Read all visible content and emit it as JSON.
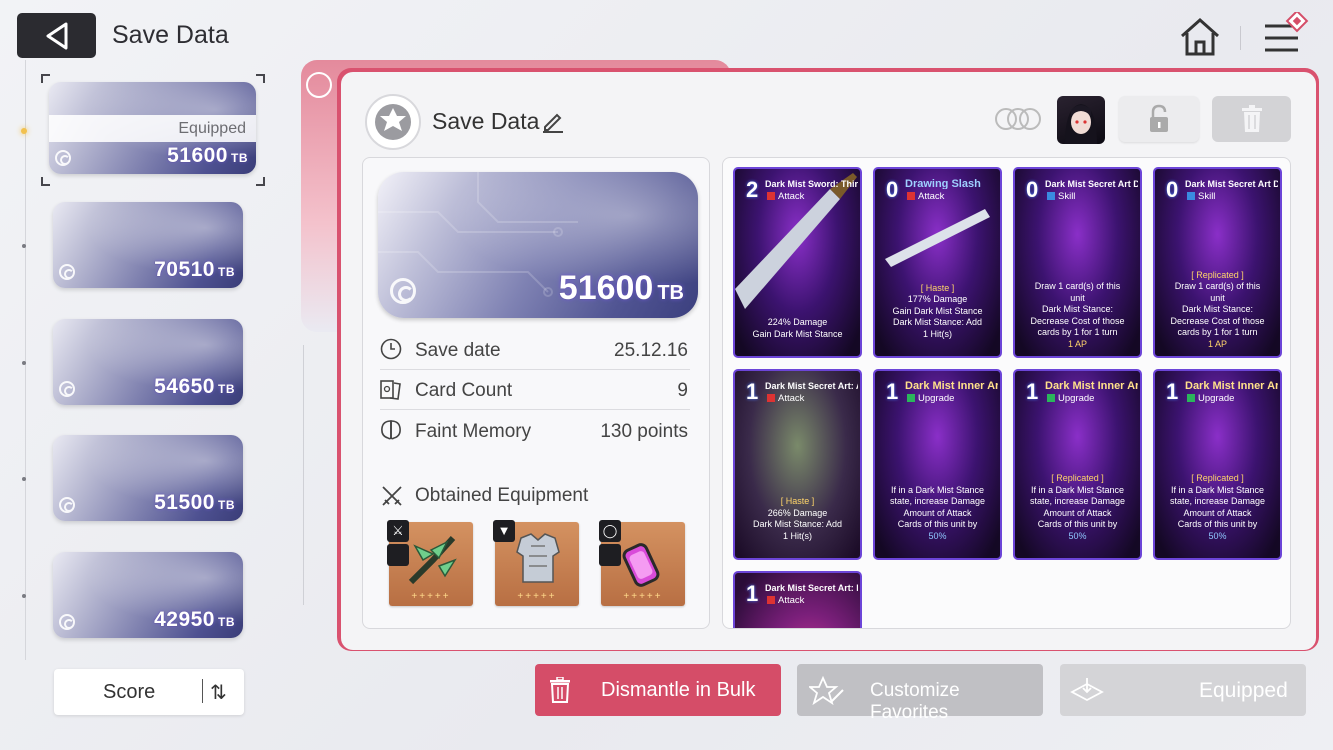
{
  "header": {
    "title": "Save Data",
    "back_icon": "back-arrow-icon",
    "home_icon": "home-icon",
    "menu_icon": "menu-icon"
  },
  "save_list": [
    {
      "value": "51600",
      "unit": "TB",
      "equipped_label": "Equipped",
      "selected": true
    },
    {
      "value": "70510",
      "unit": "TB"
    },
    {
      "value": "54650",
      "unit": "TB"
    },
    {
      "value": "51500",
      "unit": "TB"
    },
    {
      "value": "42950",
      "unit": "TB"
    }
  ],
  "sort": {
    "label": "Score"
  },
  "detail": {
    "title": "Save Data",
    "tb_value": "51600",
    "tb_unit": "TB",
    "rows": [
      {
        "label": "Save date",
        "value": "25.12.16",
        "icon": "clock-icon"
      },
      {
        "label": "Card Count",
        "value": "9",
        "icon": "cards-icon"
      },
      {
        "label": "Faint Memory",
        "value": "130 points",
        "icon": "brain-icon"
      }
    ],
    "equipment_title": "Obtained Equipment",
    "equipment": [
      {
        "name": "weapon",
        "stars": "+++++"
      },
      {
        "name": "armor",
        "stars": "+++++"
      },
      {
        "name": "accessory",
        "stars": "+++++"
      }
    ]
  },
  "cards": [
    {
      "cost": "2",
      "name": "Dark Mist Sword: Third Form",
      "type": "Attack",
      "tag": "",
      "lines": [
        "224% Damage",
        "Gain Dark Mist Stance"
      ]
    },
    {
      "cost": "0",
      "name": "Drawing Slash",
      "type": "Attack",
      "tag": "[ Haste ]",
      "lines": [
        "177% Damage",
        "Gain Dark Mist Stance",
        "Dark Mist Stance: Add",
        "1 Hit(s)"
      ]
    },
    {
      "cost": "0",
      "name": "Dark Mist Secret Art Destruction",
      "type": "Skill",
      "tag": "",
      "lines": [
        "Draw 1 card(s) of this",
        "unit",
        "Dark Mist Stance:",
        "Decrease Cost of those",
        "cards by 1 for 1 turn"
      ],
      "ap": "1 AP"
    },
    {
      "cost": "0",
      "name": "Dark Mist Secret Art Destruction",
      "type": "Skill",
      "tag": "[ Replicated ]",
      "lines": [
        "Draw 1 card(s) of this",
        "unit",
        "Dark Mist Stance:",
        "Decrease Cost of those",
        "cards by 1 for 1 turn"
      ],
      "ap": "1 AP"
    },
    {
      "cost": "1",
      "name": "Dark Mist Secret Art: Annihilation",
      "type": "Attack",
      "tag": "[ Haste ]",
      "lines": [
        "266% Damage",
        "Dark Mist Stance: Add",
        "1 Hit(s)"
      ]
    },
    {
      "cost": "1",
      "name": "Dark Mist Inner Art",
      "type": "Upgrade",
      "tag": "",
      "lines": [
        "If in a Dark Mist Stance",
        "state, increase Damage",
        "Amount of Attack",
        "Cards of this unit by",
        "50%"
      ]
    },
    {
      "cost": "1",
      "name": "Dark Mist Inner Art",
      "type": "Upgrade",
      "tag": "[ Replicated ]",
      "lines": [
        "If in a Dark Mist Stance",
        "state, increase Damage",
        "Amount of Attack",
        "Cards of this unit by",
        "50%"
      ]
    },
    {
      "cost": "1",
      "name": "Dark Mist Inner Art",
      "type": "Upgrade",
      "tag": "[ Replicated ]",
      "lines": [
        "If in a Dark Mist Stance",
        "state, increase Damage",
        "Amount of Attack",
        "Cards of this unit by",
        "50%"
      ]
    },
    {
      "cost": "1",
      "name": "Dark Mist Secret Art: Black Dance",
      "type": "Attack",
      "tag": "",
      "lines": []
    }
  ],
  "buttons": {
    "dismantle": "Dismantle in Bulk",
    "favorites": "Customize Favorites",
    "equipped": "Equipped"
  },
  "colors": {
    "accent": "#d54d68",
    "header_bg": "#2b2b30",
    "card_border": "#6c45d8"
  }
}
